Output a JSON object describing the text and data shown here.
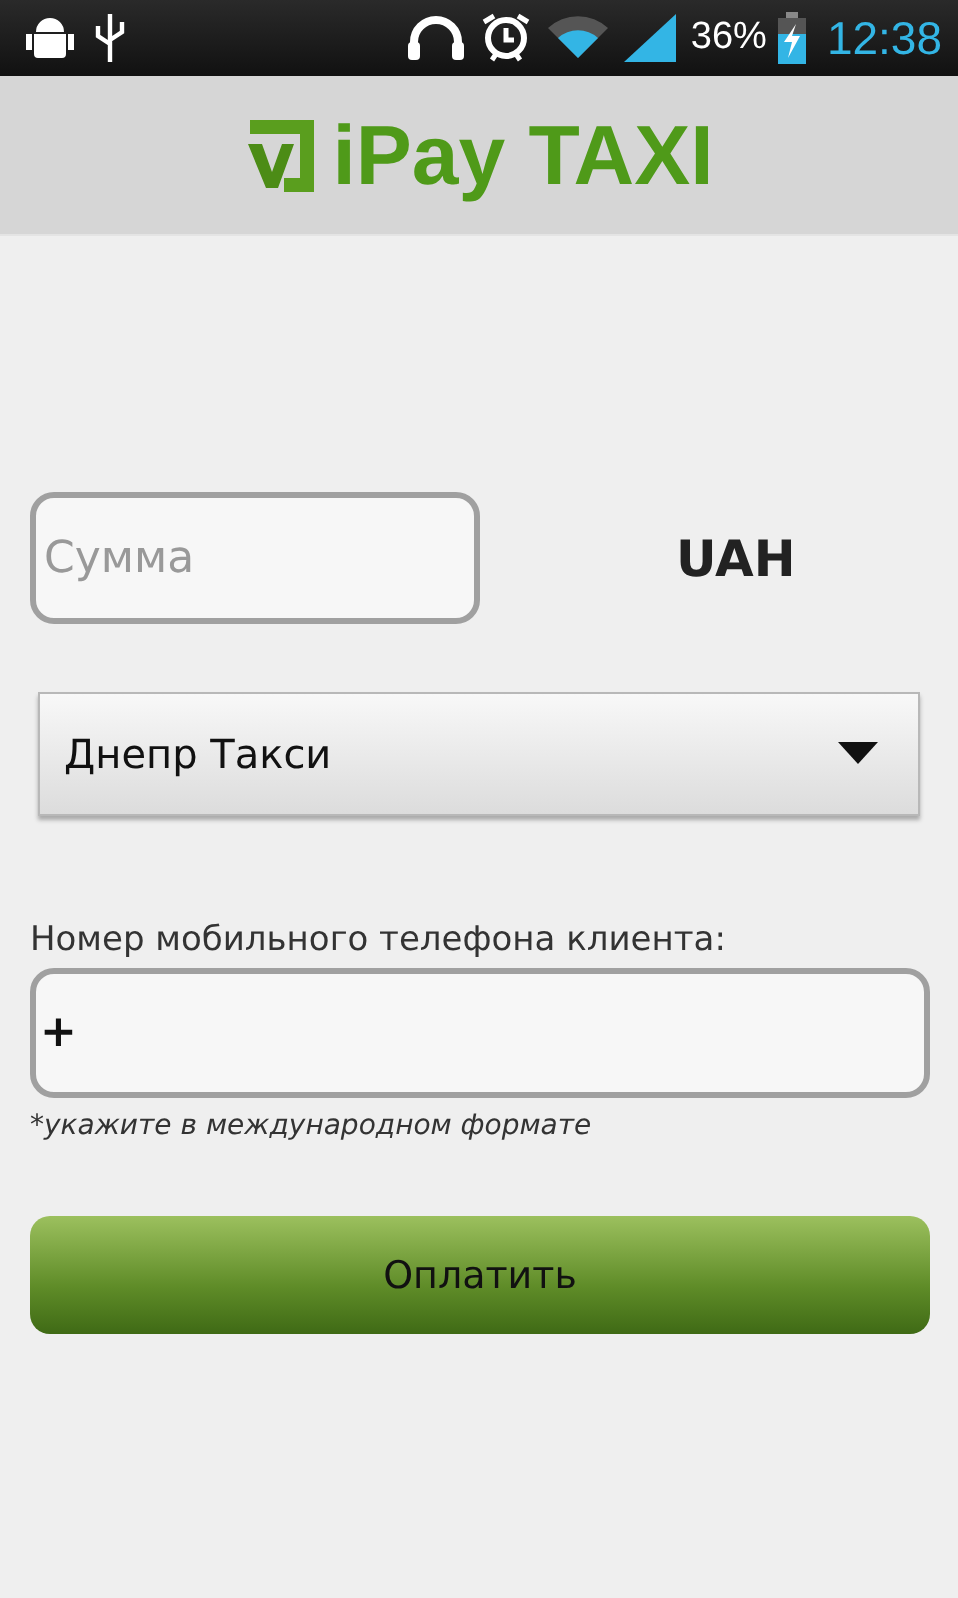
{
  "status_bar": {
    "battery_text": "36%",
    "time": "12:38"
  },
  "header": {
    "logo_text": "iPay TAXI"
  },
  "amount": {
    "placeholder": "Сумма",
    "currency": "UAH"
  },
  "taxi_select": {
    "value": "Днепр Такси"
  },
  "phone": {
    "label": "Номер мобильного телефона клиента:",
    "value": "+",
    "hint": "*укажите в международном формате"
  },
  "pay_button": {
    "label": "Оплатить"
  }
}
